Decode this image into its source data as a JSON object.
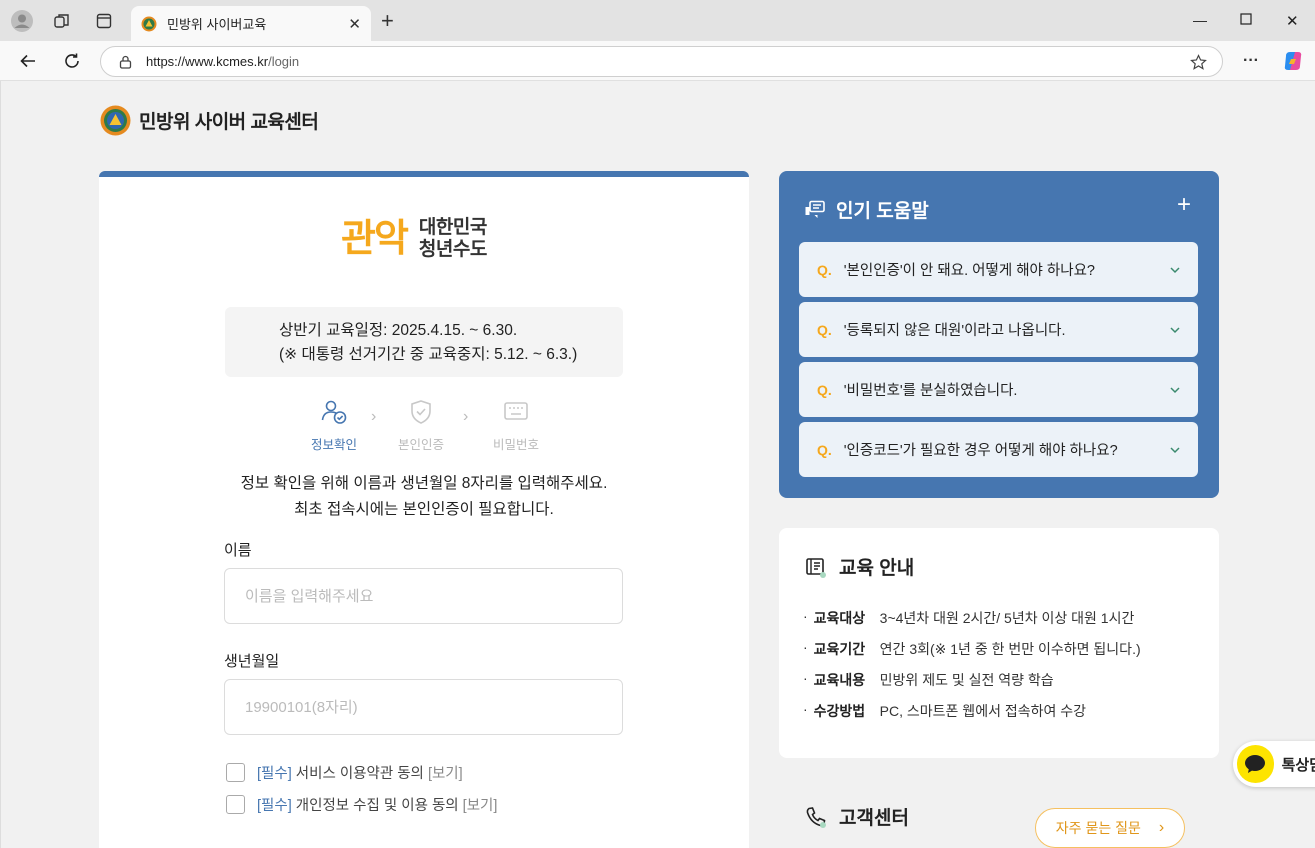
{
  "browser": {
    "tab_title": "민방위 사이버교육",
    "url_host": "https://www.kcmes.kr",
    "url_path": "/login"
  },
  "site": {
    "title": "민방위 사이버 교육센터"
  },
  "login": {
    "logo_main": "관악",
    "logo_sub_line1": "대한민국",
    "logo_sub_line2": "청년수도",
    "notice_line1": "상반기 교육일정: 2025.4.15. ~ 6.30.",
    "notice_line2": "(※ 대통령 선거기간 중 교육중지: 5.12. ~ 6.3.)",
    "steps": [
      {
        "label": "정보확인",
        "active": true
      },
      {
        "label": "본인인증",
        "active": false
      },
      {
        "label": "비밀번호",
        "active": false
      }
    ],
    "intro_line1": "정보 확인을 위해 이름과 생년월일 8자리를 입력해주세요.",
    "intro_line2": "최초 접속시에는 본인인증이 필요합니다.",
    "name_label": "이름",
    "name_placeholder": "이름을 입력해주세요",
    "birth_label": "생년월일",
    "birth_placeholder": "19900101(8자리)",
    "agree": [
      {
        "req": "[필수]",
        "text": " 서비스 이용약관 동의 ",
        "view": "[보기]"
      },
      {
        "req": "[필수]",
        "text": " 개인정보 수집 및 이용 동의 ",
        "view": "[보기]"
      }
    ]
  },
  "faq": {
    "title": "인기 도움말",
    "q_mark": "Q.",
    "items": [
      "'본인인증'이 안 돼요. 어떻게 해야 하나요?",
      "'등록되지 않은 대원'이라고 나옵니다.",
      "'비밀번호'를 분실하였습니다.",
      "'인증코드'가 필요한 경우 어떻게 해야 하나요?"
    ]
  },
  "edu": {
    "title": "교육 안내",
    "rows": [
      {
        "k": "교육대상",
        "v": "3~4년차 대원 2시간/ 5년차 이상 대원 1시간"
      },
      {
        "k": "교육기간",
        "v": "연간 3회(※ 1년 중 한 번만 이수하면 됩니다.)"
      },
      {
        "k": "교육내용",
        "v": "민방위 제도 및 실전 역량 학습"
      },
      {
        "k": "수강방법",
        "v": "PC, 스마트폰 웹에서 접속하여 수강"
      }
    ]
  },
  "contact": {
    "title": "고객센터",
    "faq_button": "자주 묻는 질문",
    "kakao_label": "톡상담"
  },
  "colors": {
    "primary": "#4676b0",
    "accent": "#f5a81d"
  }
}
